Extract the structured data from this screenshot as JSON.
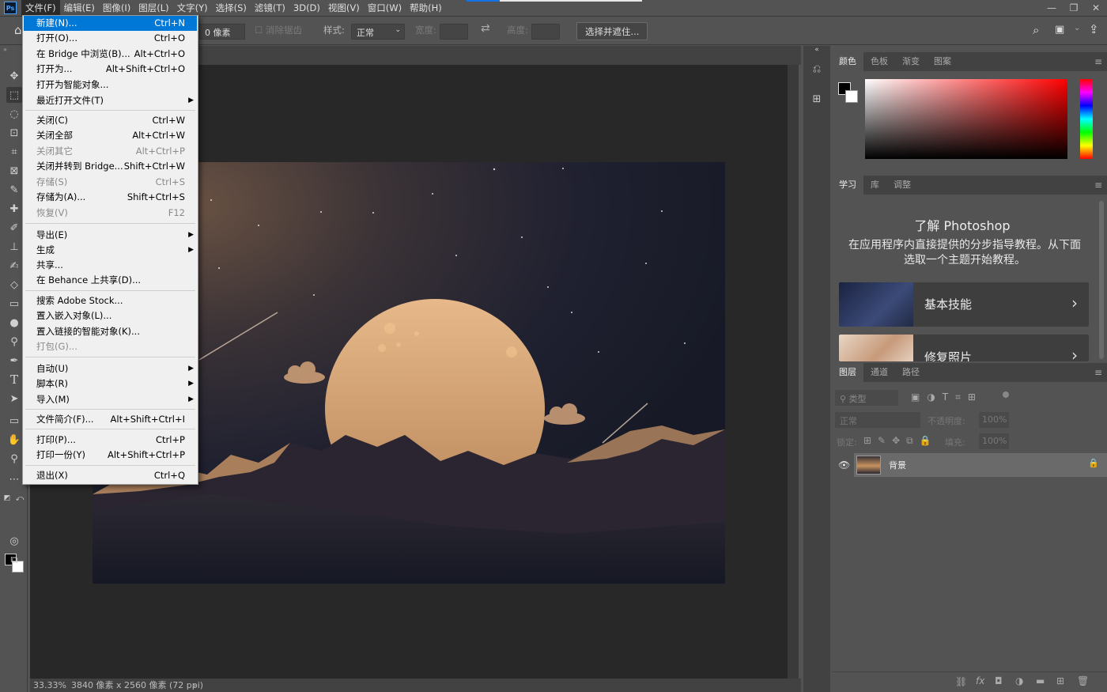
{
  "app": {
    "logo": "Ps",
    "blue_accent": "#1473e6"
  },
  "menubar": {
    "items": [
      "文件(F)",
      "编辑(E)",
      "图像(I)",
      "图层(L)",
      "文字(Y)",
      "选择(S)",
      "滤镜(T)",
      "3D(D)",
      "视图(V)",
      "窗口(W)",
      "帮助(H)"
    ],
    "window_controls": [
      "—",
      "❐",
      "✕"
    ]
  },
  "options": {
    "feather": "0 像素",
    "antialias": "消除锯齿",
    "style_label": "样式:",
    "style_value": "正常",
    "width_label": "宽度:",
    "height_label": "高度:",
    "select_mask": "选择并遮住..."
  },
  "file_menu": {
    "items": [
      {
        "label": "新建(N)...",
        "shortcut": "Ctrl+N",
        "highlighted": true
      },
      {
        "label": "打开(O)...",
        "shortcut": "Ctrl+O"
      },
      {
        "label": "在 Bridge 中浏览(B)...",
        "shortcut": "Alt+Ctrl+O"
      },
      {
        "label": "打开为...",
        "shortcut": "Alt+Shift+Ctrl+O"
      },
      {
        "label": "打开为智能对象...",
        "shortcut": ""
      },
      {
        "label": "最近打开文件(T)",
        "shortcut": "",
        "submenu": true
      },
      {
        "label": "关闭(C)",
        "shortcut": "Ctrl+W"
      },
      {
        "label": "关闭全部",
        "shortcut": "Alt+Ctrl+W"
      },
      {
        "label": "关闭其它",
        "shortcut": "Alt+Ctrl+P",
        "disabled": true
      },
      {
        "label": "关闭并转到 Bridge...",
        "shortcut": "Shift+Ctrl+W"
      },
      {
        "label": "存储(S)",
        "shortcut": "Ctrl+S",
        "disabled": true
      },
      {
        "label": "存储为(A)...",
        "shortcut": "Shift+Ctrl+S"
      },
      {
        "label": "恢复(V)",
        "shortcut": "F12",
        "disabled": true
      },
      {
        "label": "导出(E)",
        "shortcut": "",
        "submenu": true
      },
      {
        "label": "生成",
        "shortcut": "",
        "submenu": true
      },
      {
        "label": "共享...",
        "shortcut": ""
      },
      {
        "label": "在 Behance 上共享(D)...",
        "shortcut": ""
      },
      {
        "label": "搜索 Adobe Stock...",
        "shortcut": ""
      },
      {
        "label": "置入嵌入对象(L)...",
        "shortcut": ""
      },
      {
        "label": "置入链接的智能对象(K)...",
        "shortcut": ""
      },
      {
        "label": "打包(G)...",
        "shortcut": "",
        "disabled": true
      },
      {
        "label": "自动(U)",
        "shortcut": "",
        "submenu": true
      },
      {
        "label": "脚本(R)",
        "shortcut": "",
        "submenu": true
      },
      {
        "label": "导入(M)",
        "shortcut": "",
        "submenu": true
      },
      {
        "label": "文件简介(F)...",
        "shortcut": "Alt+Shift+Ctrl+I"
      },
      {
        "label": "打印(P)...",
        "shortcut": "Ctrl+P"
      },
      {
        "label": "打印一份(Y)",
        "shortcut": "Alt+Shift+Ctrl+P"
      },
      {
        "label": "退出(X)",
        "shortcut": "Ctrl+Q"
      }
    ]
  },
  "status": {
    "zoom": "33.33%",
    "doc_info": "3840 像素 x 2560 像素 (72 ppi)"
  },
  "color_panel": {
    "tabs": [
      "颜色",
      "色板",
      "渐变",
      "图案"
    ],
    "hue": "#ff0000"
  },
  "learn_panel": {
    "tabs": [
      "学习",
      "库",
      "调整"
    ],
    "title": "了解 Photoshop",
    "desc": "在应用程序内直接提供的分步指导教程。从下面选取一个主题开始教程。",
    "cards": [
      "基本技能",
      "修复照片"
    ]
  },
  "layers_panel": {
    "tabs": [
      "图层",
      "通道",
      "路径"
    ],
    "filter_placeholder": "类型",
    "blend_mode": "正常",
    "opacity_label": "不透明度:",
    "opacity_value": "100%",
    "lock_label": "锁定:",
    "fill_label": "填充:",
    "fill_value": "100%",
    "layer_name": "背景"
  }
}
